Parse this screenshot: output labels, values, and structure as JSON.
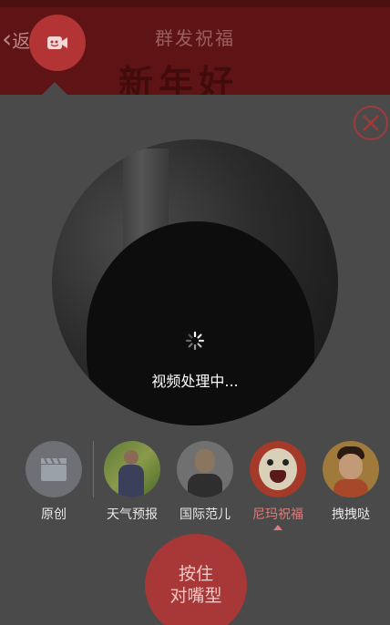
{
  "header": {
    "back_label": "返",
    "title": "群发祝福",
    "banner_text": "新年好"
  },
  "video": {
    "processing_text": "视频处理中..."
  },
  "filters": [
    {
      "label": "原创",
      "icon": "clapperboard-icon"
    },
    {
      "label": "天气预报",
      "icon": "weather-presenter-avatar"
    },
    {
      "label": "国际范儿",
      "icon": "man-avatar"
    },
    {
      "label": "尼玛祝福",
      "icon": "cartoon-face-avatar",
      "active": true
    },
    {
      "label": "拽拽哒",
      "icon": "boy-avatar"
    }
  ],
  "hold_button": {
    "line1": "按住",
    "line2": "对嘴型"
  },
  "colors": {
    "accent": "#b23434",
    "active_label": "#e07a7a"
  }
}
